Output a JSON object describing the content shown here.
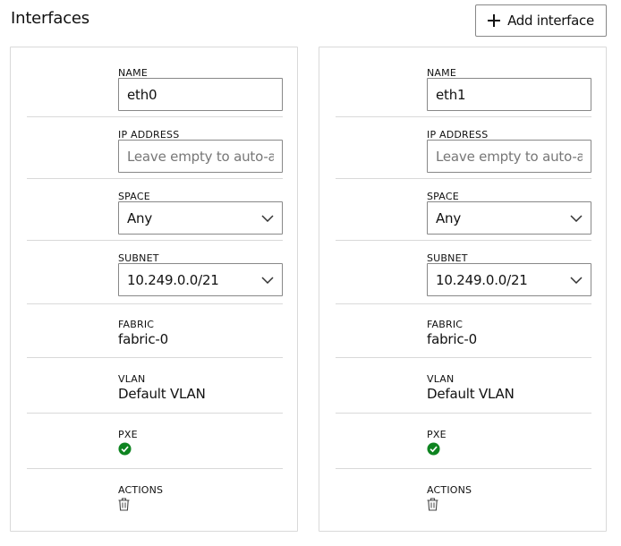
{
  "header": {
    "title": "Interfaces",
    "add_button_label": "Add interface"
  },
  "labels": {
    "name": "NAME",
    "ip_address": "IP ADDRESS",
    "space": "SPACE",
    "subnet": "SUBNET",
    "fabric": "FABRIC",
    "vlan": "VLAN",
    "pxe": "PXE",
    "actions": "ACTIONS"
  },
  "interfaces": [
    {
      "name": "eth0",
      "ip_address": "",
      "ip_placeholder": "Leave empty to auto-assign",
      "space": "Any",
      "subnet": "10.249.0.0/21",
      "fabric": "fabric-0",
      "vlan": "Default VLAN",
      "pxe": true
    },
    {
      "name": "eth1",
      "ip_address": "",
      "ip_placeholder": "Leave empty to auto-assign",
      "space": "Any",
      "subnet": "10.249.0.0/21",
      "fabric": "fabric-0",
      "vlan": "Default VLAN",
      "pxe": true
    }
  ],
  "colors": {
    "border": "#d9d9d9",
    "input_border": "#888888",
    "pxe_check": "#0e8420",
    "placeholder": "#777777"
  },
  "icons": {
    "add": "plus-icon",
    "dropdown": "chevron-down-icon",
    "pxe": "check-circle-icon",
    "delete": "trash-icon"
  }
}
